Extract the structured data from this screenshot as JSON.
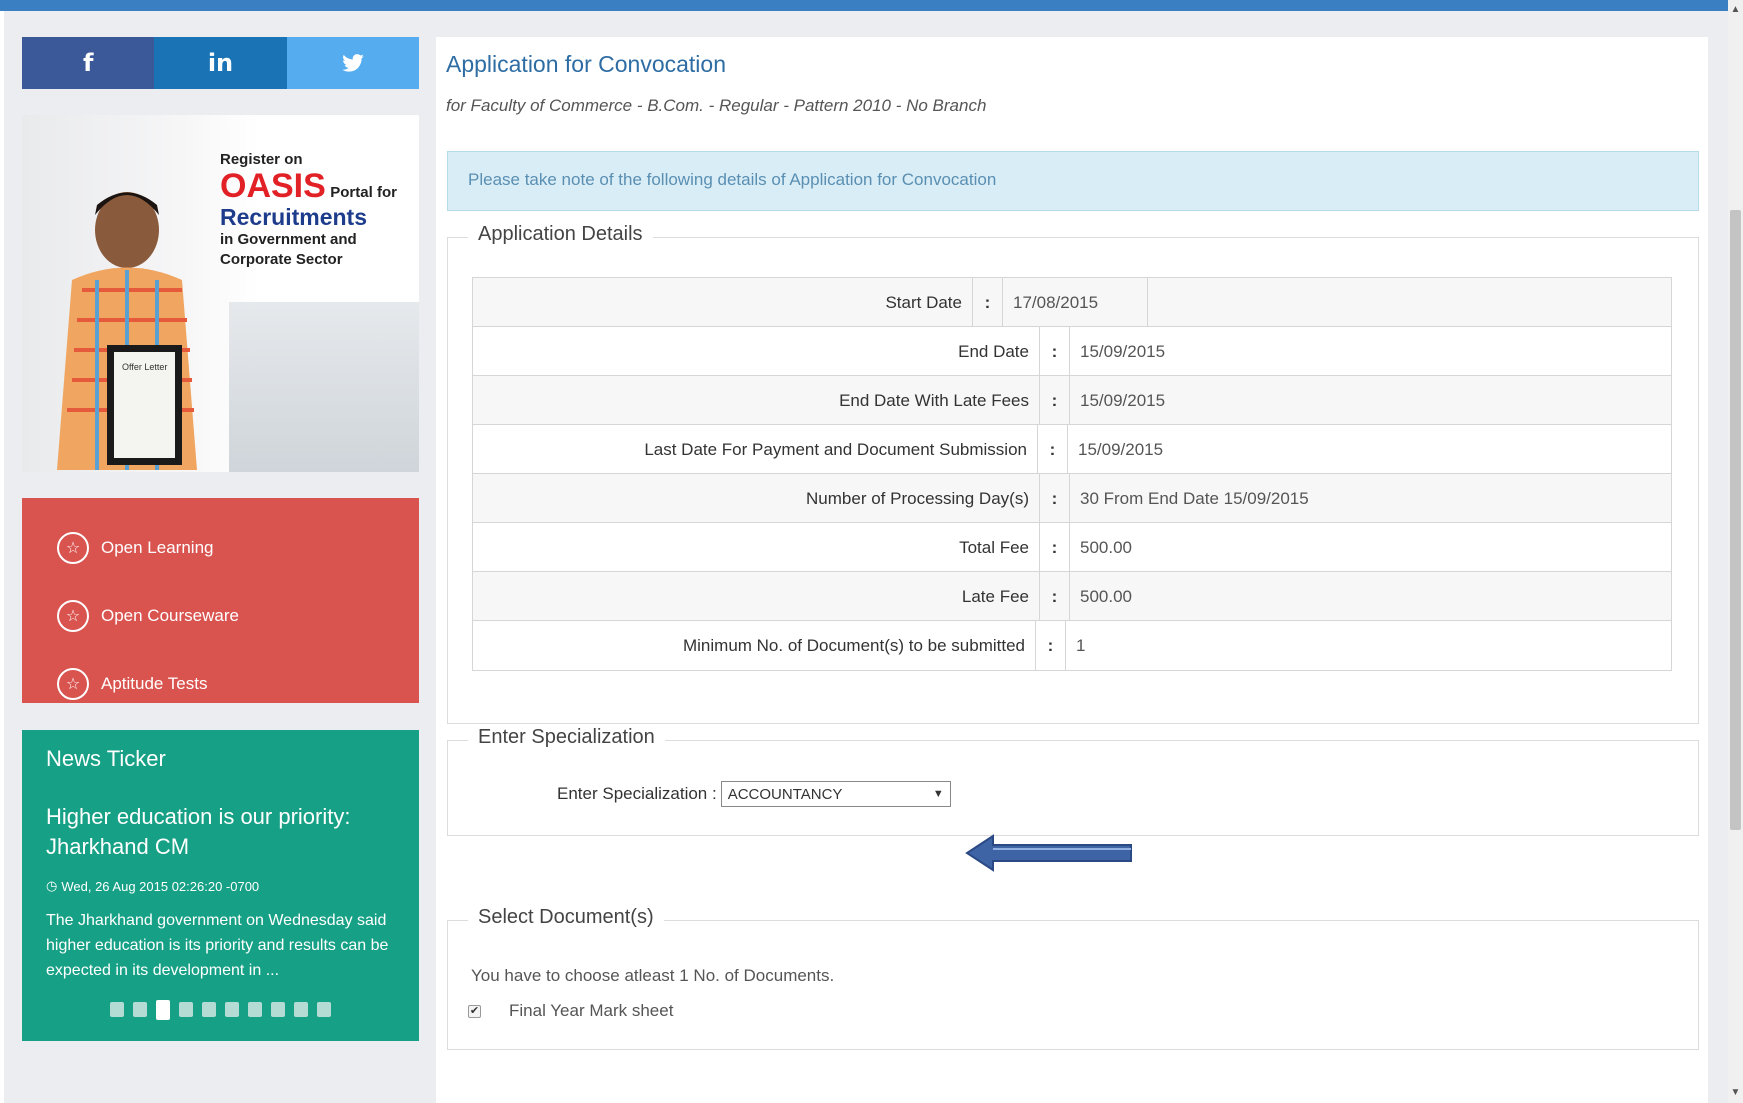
{
  "social": {
    "facebook": "f",
    "linkedin": "in",
    "twitter": "🐦"
  },
  "banner": {
    "line1": "Register on",
    "oasis": "OASIS",
    "portal": "Portal for",
    "recruitments": "Recruitments",
    "line4": "in Government and",
    "line5": "Corporate Sector",
    "offer_letter": "Offer Letter"
  },
  "menu": {
    "items": [
      {
        "label": "Open Learning",
        "icon": "star-icon"
      },
      {
        "label": "Open Courseware",
        "icon": "star-icon"
      },
      {
        "label": "Aptitude Tests",
        "icon": "star-icon"
      }
    ]
  },
  "news": {
    "title": "News Ticker",
    "headline": "Higher education is our priority: Jharkhand CM",
    "date": "Wed, 26 Aug 2015 02:26:20 -0700",
    "body": "The Jharkhand government on Wednesday said higher education is its priority and results can be expected in its development in ...",
    "dots_total": 10,
    "active_dot": 3
  },
  "main": {
    "title": "Application for Convocation",
    "subtitle": "for Faculty of Commerce - B.Com. - Regular - Pattern 2010 - No Branch",
    "alert": "Please take note of the following details of Application for Convocation"
  },
  "details": {
    "legend": "Application Details",
    "rows": [
      {
        "label": "Start Date",
        "value": "17/08/2015"
      },
      {
        "label": "End Date",
        "value": "15/09/2015"
      },
      {
        "label": "End Date With Late Fees",
        "value": "15/09/2015"
      },
      {
        "label": "Last Date For Payment and Document Submission",
        "value": "15/09/2015"
      },
      {
        "label": "Number of Processing Day(s)",
        "value": "30 From End Date 15/09/2015"
      },
      {
        "label": "Total Fee",
        "value": "500.00"
      },
      {
        "label": "Late Fee",
        "value": "500.00"
      },
      {
        "label": "Minimum No. of Document(s) to be submitted",
        "value": "1"
      }
    ],
    "colon": ":"
  },
  "specialization": {
    "legend": "Enter Specialization",
    "label": "Enter Specialization :",
    "selected": "ACCOUNTANCY"
  },
  "documents": {
    "legend": "Select Document(s)",
    "note": "You have to choose atleast 1 No. of Documents.",
    "item": "Final Year Mark sheet",
    "checked": true
  },
  "colors": {
    "accent": "#3a7fc1",
    "red_menu": "#d9534f",
    "news_bg": "#16a085",
    "alert_bg": "#d9edf7",
    "arrow": "#3e64a6"
  }
}
